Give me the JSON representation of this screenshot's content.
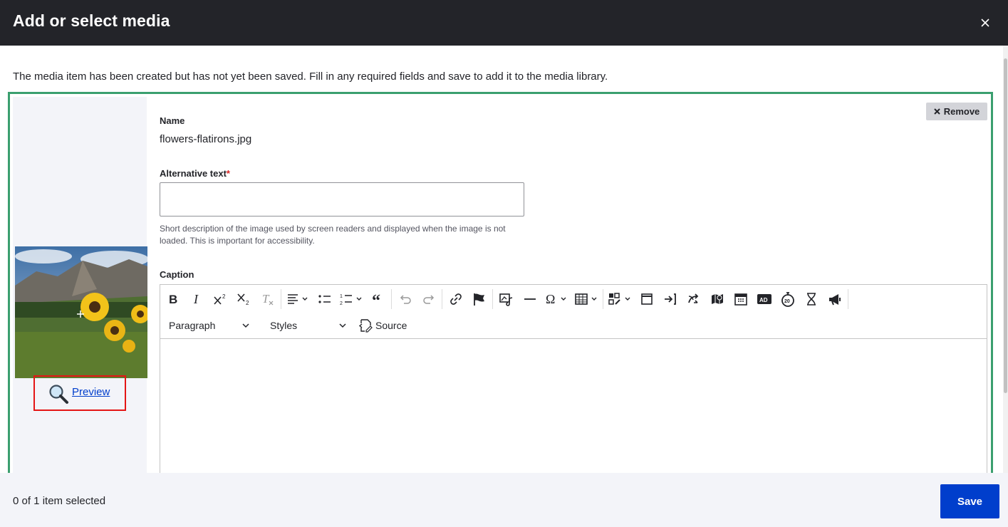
{
  "dialog": {
    "title": "Add or select media"
  },
  "message": "The media item has been created but has not yet been saved. Fill in any required fields and save to add it to the media library.",
  "media_item": {
    "remove_label": "Remove",
    "preview_label": "Preview",
    "name": {
      "label": "Name",
      "value": "flowers-flatirons.jpg"
    },
    "alt_text": {
      "label": "Alternative text",
      "required_marker": "*",
      "value": "",
      "description": "Short description of the image used by screen readers and displayed when the image is not loaded. This is important for accessibility."
    },
    "caption": {
      "label": "Caption",
      "toolbar": {
        "paragraph_label": "Paragraph",
        "styles_label": "Styles",
        "source_label": "Source"
      }
    }
  },
  "footer": {
    "selection_count": "0 of 1 item selected",
    "save_label": "Save"
  },
  "colors": {
    "titlebar": "#232429",
    "accent_border": "#3b9f6f",
    "primary_button": "#003ecc",
    "highlight": "#e41515"
  }
}
